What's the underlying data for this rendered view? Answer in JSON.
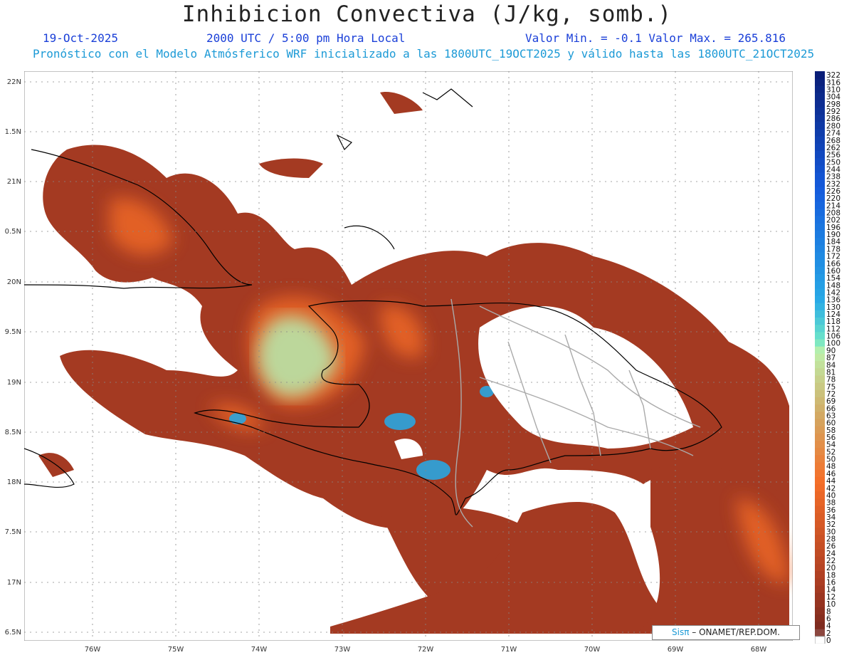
{
  "title": "Inhibicion Convectiva (J/kg, somb.)",
  "header": {
    "date": "19-Oct-2025",
    "time": "2000 UTC / 5:00 pm Hora Local",
    "minmax": "Valor Min. = -0.1  Valor Max. = 265.816",
    "model_line": "Pronóstico con el Modelo Atmósferico WRF inicializado a las 1800UTC_19OCT2025 y válido hasta las  1800UTC_21OCT2025"
  },
  "axes": {
    "lat_labels": [
      "22N",
      "1.5N",
      "21N",
      "0.5N",
      "20N",
      "9.5N",
      "19N",
      "8.5N",
      "18N",
      "7.5N",
      "17N",
      "6.5N"
    ],
    "lon_labels": [
      "76W",
      "75W",
      "74W",
      "73W",
      "72W",
      "71W",
      "70W",
      "69W",
      "68W"
    ]
  },
  "legend": {
    "values": [
      "322",
      "316",
      "310",
      "304",
      "298",
      "292",
      "286",
      "280",
      "274",
      "268",
      "262",
      "256",
      "250",
      "244",
      "238",
      "232",
      "226",
      "220",
      "214",
      "208",
      "202",
      "196",
      "190",
      "184",
      "178",
      "172",
      "166",
      "160",
      "154",
      "148",
      "142",
      "136",
      "130",
      "124",
      "118",
      "112",
      "106",
      "100",
      "90",
      "87",
      "84",
      "81",
      "78",
      "75",
      "72",
      "69",
      "66",
      "63",
      "60",
      "58",
      "56",
      "54",
      "52",
      "50",
      "48",
      "46",
      "44",
      "42",
      "40",
      "38",
      "36",
      "34",
      "32",
      "30",
      "28",
      "26",
      "24",
      "22",
      "20",
      "18",
      "16",
      "14",
      "12",
      "10",
      "8",
      "6",
      "4",
      "2",
      "0"
    ]
  },
  "credit": {
    "brand": "Sisπ",
    "org": "– ONAMET/REP.DOM."
  },
  "colors": {
    "low": "#a43a22",
    "mid": "#f26a28",
    "high": "#b6ecb0",
    "max": "#2aa6e0",
    "title": "#222222",
    "header_blue": "#1a3fd8",
    "header_cyan": "#1c9ad6"
  }
}
